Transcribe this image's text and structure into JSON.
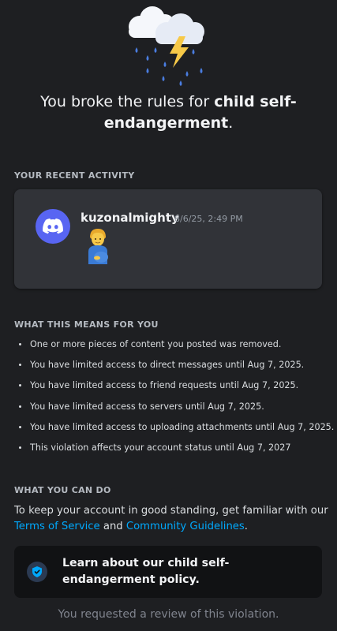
{
  "headline": {
    "prefix": "You broke the rules for ",
    "bold": "child self-endangerment",
    "suffix": "."
  },
  "recent_activity": {
    "title": "YOUR RECENT ACTIVITY",
    "username": "kuzonalmighty",
    "timestamp": "8/6/25, 2:49 PM",
    "message_emoji": "🫃",
    "avatar_icon": "discord-logo-icon",
    "avatar_color": "#5865f2"
  },
  "what_this_means": {
    "title": "WHAT THIS MEANS FOR YOU",
    "items": [
      "One or more pieces of content you posted was removed.",
      "You have limited access to direct messages until Aug 7, 2025.",
      "You have limited access to friend requests until Aug 7, 2025.",
      "You have limited access to servers until Aug 7, 2025.",
      "You have limited access to uploading attachments until Aug 7, 2025.",
      "This violation affects your account status until Aug 7, 2027"
    ]
  },
  "what_you_can_do": {
    "title": "WHAT YOU CAN DO",
    "text_before": "To keep your account in good standing, get familiar with our ",
    "link_terms": "Terms of Service",
    "text_and": " and ",
    "link_guidelines": "Community Guidelines",
    "text_end": "."
  },
  "policy_button": {
    "label": "Learn about our child self-endangerment policy.",
    "icon": "shield-icon"
  },
  "review_status": "You requested a review of this violation.",
  "colors": {
    "background": "#1e1f22",
    "card": "#313338",
    "link": "#00a8fc",
    "accent": "#5865f2"
  }
}
